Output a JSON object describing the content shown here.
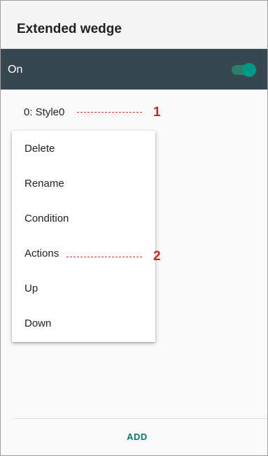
{
  "app_bar": {
    "title": "Extended wedge"
  },
  "master_switch": {
    "label": "On",
    "checked": true,
    "accent": "#009688"
  },
  "style_list": {
    "items": [
      {
        "label": "0: Style0"
      }
    ]
  },
  "context_menu": {
    "items": [
      {
        "label": "Delete"
      },
      {
        "label": "Rename"
      },
      {
        "label": "Condition"
      },
      {
        "label": "Actions"
      },
      {
        "label": "Up"
      },
      {
        "label": "Down"
      }
    ]
  },
  "callouts": [
    {
      "number": "1"
    },
    {
      "number": "2"
    }
  ],
  "footer": {
    "add_label": "ADD"
  },
  "colors": {
    "header_bar": "#37474f",
    "callout": "#c62828",
    "add_text": "#00796b"
  }
}
